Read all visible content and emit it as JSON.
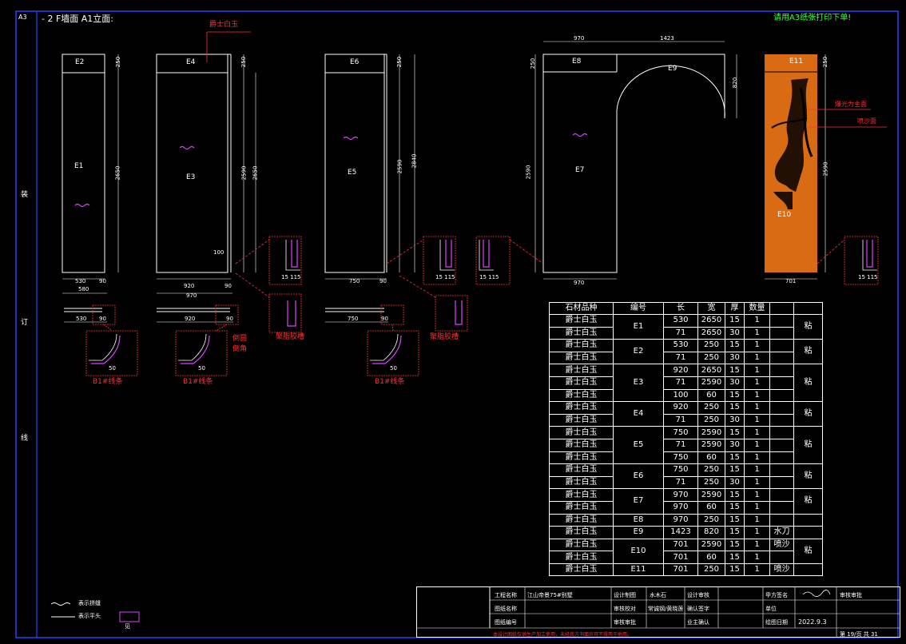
{
  "sheet": {
    "size_label": "A3",
    "title": "- 2 F墙面 A1立面:",
    "print_note": "请用A3纸张打印下单!",
    "margin_chars": [
      "装",
      "订",
      "线"
    ]
  },
  "panels": {
    "e2": "E2",
    "e1": "E1",
    "e4": "E4",
    "e3": "E3",
    "e6": "E6",
    "e5": "E5",
    "e8": "E8",
    "e9": "E9",
    "e7": "E7",
    "e11": "E11",
    "e10": "E10"
  },
  "dims": {
    "d250": "250",
    "d2650": "2650",
    "d2590": "2590",
    "d2840": "2840",
    "d820": "820",
    "d530": "530",
    "d90": "90",
    "d580": "580",
    "d920": "920",
    "d970": "970",
    "d750": "750",
    "d1423": "1423",
    "d701": "701",
    "d100": "100",
    "d50": "50",
    "d15": "15",
    "d60": "60",
    "d15_115": "15 115"
  },
  "callouts": {
    "stone_name": "爵士白玉",
    "edge_profile": "B1#线条",
    "round_edge": "倒圆\n倒角",
    "stair_detail": "聚脂胶槽",
    "waterjet_face": "爆光为主面",
    "sandblast": "喷沙面"
  },
  "legend": {
    "wave_label": "表示拼缝",
    "joint_label": "表示平头",
    "box_label": "见"
  },
  "schedule": {
    "headers": [
      "石材品种",
      "编号",
      "长",
      "宽",
      "厚",
      "数量",
      "",
      ""
    ],
    "rows": [
      [
        "爵士白玉",
        "E1",
        "530",
        "2650",
        "15",
        "1",
        "",
        "粘"
      ],
      [
        "爵士白玉",
        "",
        "71",
        "2650",
        "30",
        "1",
        "",
        ""
      ],
      [
        "爵士白玉",
        "E2",
        "530",
        "250",
        "15",
        "1",
        "",
        "粘"
      ],
      [
        "爵士白玉",
        "",
        "71",
        "250",
        "30",
        "1",
        "",
        ""
      ],
      [
        "爵士白玉",
        "E3",
        "920",
        "2650",
        "15",
        "1",
        "",
        "粘"
      ],
      [
        "爵士白玉",
        "",
        "71",
        "2590",
        "30",
        "1",
        "",
        ""
      ],
      [
        "爵士白玉",
        "",
        "100",
        "60",
        "15",
        "1",
        "",
        ""
      ],
      [
        "爵士白玉",
        "E4",
        "920",
        "250",
        "15",
        "1",
        "",
        "粘"
      ],
      [
        "爵士白玉",
        "",
        "71",
        "250",
        "30",
        "1",
        "",
        ""
      ],
      [
        "爵士白玉",
        "E5",
        "750",
        "2590",
        "15",
        "1",
        "",
        "粘"
      ],
      [
        "爵士白玉",
        "",
        "71",
        "2590",
        "30",
        "1",
        "",
        ""
      ],
      [
        "爵士白玉",
        "",
        "750",
        "60",
        "15",
        "1",
        "",
        ""
      ],
      [
        "爵士白玉",
        "E6",
        "750",
        "250",
        "15",
        "1",
        "",
        "粘"
      ],
      [
        "爵士白玉",
        "",
        "71",
        "250",
        "30",
        "1",
        "",
        ""
      ],
      [
        "爵士白玉",
        "E7",
        "970",
        "2590",
        "15",
        "1",
        "",
        "粘"
      ],
      [
        "爵士白玉",
        "",
        "970",
        "60",
        "15",
        "1",
        "",
        ""
      ],
      [
        "爵士白玉",
        "E8",
        "970",
        "250",
        "15",
        "1",
        "",
        ""
      ],
      [
        "爵士白玉",
        "E9",
        "1423",
        "820",
        "15",
        "1",
        "水刀",
        ""
      ],
      [
        "爵士白玉",
        "E10",
        "701",
        "2590",
        "15",
        "1",
        "喷沙",
        "粘"
      ],
      [
        "爵士白玉",
        "",
        "701",
        "60",
        "15",
        "1",
        "",
        ""
      ],
      [
        "爵士白玉",
        "E11",
        "701",
        "250",
        "15",
        "1",
        "喷沙",
        ""
      ]
    ]
  },
  "title_block": {
    "project_label": "工程名称",
    "project_value": "江山帝景75#别墅",
    "drawing_label": "图纸名称",
    "drawing_value": "",
    "no_label": "图纸编号",
    "no_value": "",
    "designer_label": "设计制图",
    "designer_value": "水木石",
    "checker_label": "审核校对",
    "checker_value": "常诚钢/黄晓莲",
    "approver_label": "审核审批",
    "approver_value": "",
    "design_label": "设计审核",
    "design_value": "",
    "confirm_label": "确认签字",
    "confirm_value": "",
    "owner_label": "业主确认",
    "owner_value": "",
    "unit_label": "单位",
    "unit_value": "",
    "drawn_label": "绘图日期",
    "drawn_value": "2022.9.3",
    "client_label": "甲方签名",
    "footer_note": "本设计图纸仅供生产加工使用，未经我方书面许可不得用于他用。",
    "page_label": "第 19/页 共 31"
  }
}
